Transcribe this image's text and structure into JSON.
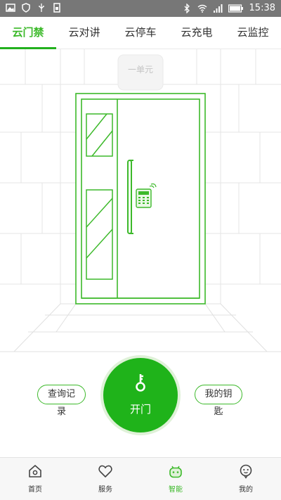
{
  "status_bar": {
    "time": "15:38"
  },
  "tabs": [
    {
      "label": "云门禁",
      "active": true
    },
    {
      "label": "云对讲",
      "active": false
    },
    {
      "label": "云停车",
      "active": false
    },
    {
      "label": "云充电",
      "active": false
    },
    {
      "label": "云监控",
      "active": false
    }
  ],
  "scene": {
    "unit_sign": "一单元"
  },
  "actions": {
    "query_records": "查询记录",
    "open_door": "开门",
    "my_keys": "我的钥匙"
  },
  "bottom_nav": [
    {
      "label": "首页",
      "icon": "home-icon",
      "active": false
    },
    {
      "label": "服务",
      "icon": "heart-icon",
      "active": false
    },
    {
      "label": "智能",
      "icon": "robot-icon",
      "active": true
    },
    {
      "label": "我的",
      "icon": "profile-icon",
      "active": false
    }
  ],
  "colors": {
    "accent": "#1fb31a",
    "accent_text": "#3cb92a",
    "line": "#dcdcdc"
  }
}
